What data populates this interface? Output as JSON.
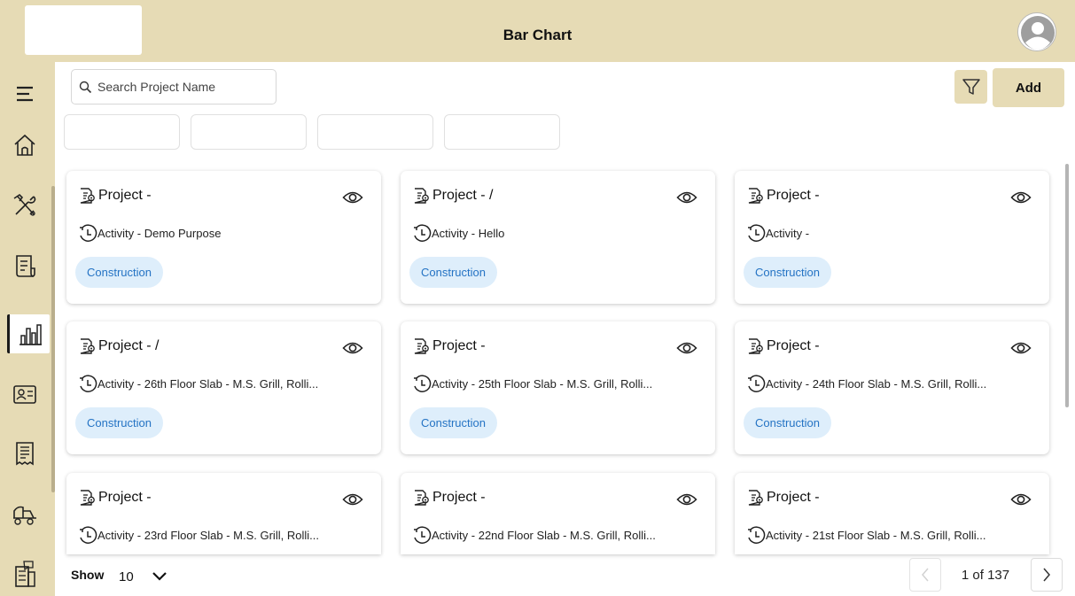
{
  "header": {
    "title": "Bar Chart"
  },
  "sidebar": {
    "items": [
      {
        "name": "menu-icon"
      },
      {
        "name": "home-icon"
      },
      {
        "name": "tools-icon"
      },
      {
        "name": "report-icon"
      },
      {
        "name": "bar-chart-icon",
        "active": true
      },
      {
        "name": "contact-card-icon"
      },
      {
        "name": "receipt-icon"
      },
      {
        "name": "machinery-icon"
      },
      {
        "name": "building-icon"
      }
    ]
  },
  "toolbar": {
    "search_placeholder": "Search Project Name",
    "add_label": "Add"
  },
  "cards": [
    {
      "project": "Project -",
      "activity": "Activity - Demo Purpose",
      "category": "Construction"
    },
    {
      "project": "Project - /",
      "activity": "Activity - Hello",
      "category": "Construction"
    },
    {
      "project": "Project -",
      "activity": "Activity -",
      "category": "Construction"
    },
    {
      "project": "Project - /",
      "activity": "Activity - 26th Floor Slab - M.S. Grill, Rolli...",
      "category": "Construction"
    },
    {
      "project": "Project -",
      "activity": "Activity - 25th Floor Slab - M.S. Grill, Rolli...",
      "category": "Construction"
    },
    {
      "project": "Project -",
      "activity": "Activity - 24th Floor Slab - M.S. Grill, Rolli...",
      "category": "Construction"
    },
    {
      "project": "Project -",
      "activity": "Activity - 23rd Floor Slab - M.S. Grill, Rolli..."
    },
    {
      "project": "Project -",
      "activity": "Activity - 22nd Floor Slab - M.S. Grill, Rolli..."
    },
    {
      "project": "Project -",
      "activity": "Activity - 21st Floor Slab - M.S. Grill, Rolli..."
    }
  ],
  "pagination": {
    "show_label": "Show",
    "page_size": "10",
    "page_info": "1 of 137"
  },
  "colors": {
    "accent": "#e6dbb5",
    "badge_bg": "#deeefb",
    "badge_text": "#2473c4"
  }
}
